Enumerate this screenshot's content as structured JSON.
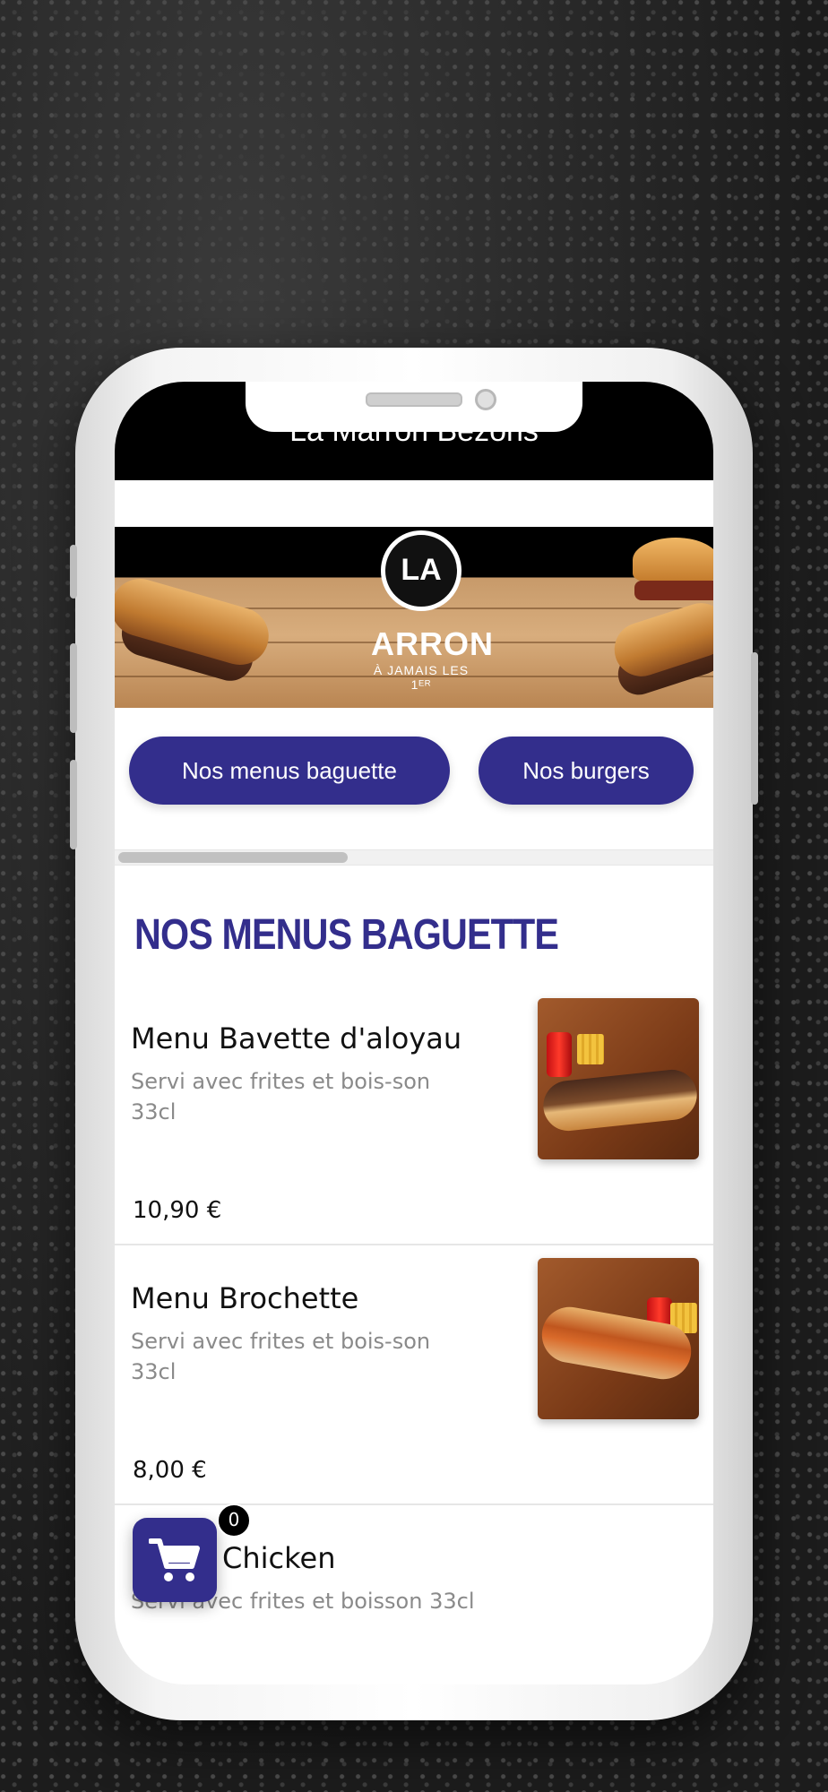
{
  "app": {
    "title": "La Marron Bezons"
  },
  "banner": {
    "logo_top": "LA",
    "logo_brand": "ARRON",
    "logo_tag": "À JAMAIS LES 1ᴱᴿ"
  },
  "categories": [
    {
      "label": "Nos menus baguette"
    },
    {
      "label": "Nos burgers"
    }
  ],
  "section": {
    "title": "NOS MENUS BAGUETTE"
  },
  "items": [
    {
      "name": "Menu Bavette d'aloyau",
      "description": "Servi avec frites et bois-son 33cl",
      "price": "10,90 €"
    },
    {
      "name": "Menu Brochette",
      "description": "Servi avec frites et bois-son 33cl",
      "price": "8,00 €"
    },
    {
      "name": "Chicken",
      "description": "Servi avec frites et boisson 33cl",
      "price": ""
    }
  ],
  "cart": {
    "count": "0",
    "icon": "cart-icon"
  },
  "colors": {
    "accent": "#332e8c",
    "header": "#000000"
  }
}
